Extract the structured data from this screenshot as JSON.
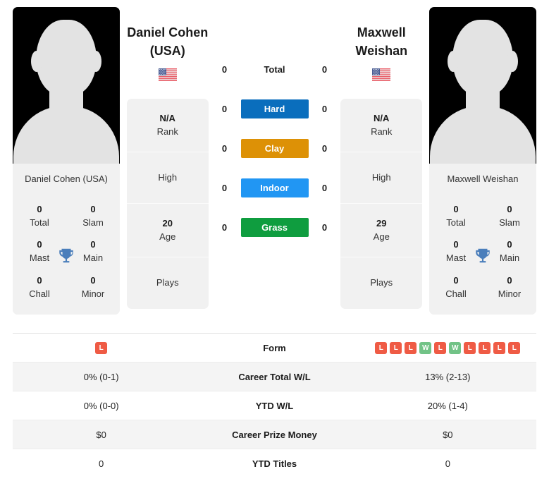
{
  "colors": {
    "win": "#72c387",
    "loss": "#ef5b45",
    "hard": "#0a6ebd",
    "clay": "#dd9106",
    "indoor": "#2196f3",
    "grass": "#0f9d3f",
    "trophy": "#4a7ebb"
  },
  "player_left": {
    "name": "Daniel Cohen\n(USA)",
    "name_line1": "Daniel Cohen",
    "name_line2": "(USA)",
    "flag": "🇺🇸",
    "flag_name": "usa-flag",
    "photo_caption": "Daniel Cohen (USA)",
    "rank_value": "N/A",
    "rank_label": "Rank",
    "high_label": "High",
    "age_value": "20",
    "age_label": "Age",
    "plays_label": "Plays",
    "titles": [
      {
        "value": "0",
        "label": "Total"
      },
      {
        "value": "0",
        "label": "Slam"
      },
      {
        "value": "0",
        "label": "Mast"
      },
      {
        "value": "0",
        "label": "Main"
      },
      {
        "value": "0",
        "label": "Chall"
      },
      {
        "value": "0",
        "label": "Minor"
      }
    ]
  },
  "player_right": {
    "name_line1": "Maxwell",
    "name_line2": "Weishan",
    "flag": "🇺🇸",
    "flag_name": "usa-flag",
    "photo_caption": "Maxwell Weishan",
    "rank_value": "N/A",
    "rank_label": "Rank",
    "high_label": "High",
    "age_value": "29",
    "age_label": "Age",
    "plays_label": "Plays",
    "titles": [
      {
        "value": "0",
        "label": "Total"
      },
      {
        "value": "0",
        "label": "Slam"
      },
      {
        "value": "0",
        "label": "Mast"
      },
      {
        "value": "0",
        "label": "Main"
      },
      {
        "value": "0",
        "label": "Chall"
      },
      {
        "value": "0",
        "label": "Minor"
      }
    ]
  },
  "surfaces": [
    {
      "label": "Total",
      "left": "0",
      "right": "0",
      "style": "plain",
      "color": ""
    },
    {
      "label": "Hard",
      "left": "0",
      "right": "0",
      "style": "badge",
      "color": "#0a6ebd"
    },
    {
      "label": "Clay",
      "left": "0",
      "right": "0",
      "style": "badge",
      "color": "#dd9106"
    },
    {
      "label": "Indoor",
      "left": "0",
      "right": "0",
      "style": "badge",
      "color": "#2196f3"
    },
    {
      "label": "Grass",
      "left": "0",
      "right": "0",
      "style": "badge",
      "color": "#0f9d3f"
    }
  ],
  "table": {
    "rows": [
      {
        "label": "Form",
        "type": "form",
        "left_form": [
          "L"
        ],
        "right_form": [
          "L",
          "L",
          "L",
          "W",
          "L",
          "W",
          "L",
          "L",
          "L",
          "L"
        ],
        "alt": false
      },
      {
        "label": "Career Total W/L",
        "type": "text",
        "left": "0% (0-1)",
        "right": "13% (2-13)",
        "alt": true
      },
      {
        "label": "YTD W/L",
        "type": "text",
        "left": "0% (0-0)",
        "right": "20% (1-4)",
        "alt": false
      },
      {
        "label": "Career Prize Money",
        "type": "text",
        "left": "$0",
        "right": "$0",
        "alt": true
      },
      {
        "label": "YTD Titles",
        "type": "text",
        "left": "0",
        "right": "0",
        "alt": false
      }
    ]
  }
}
